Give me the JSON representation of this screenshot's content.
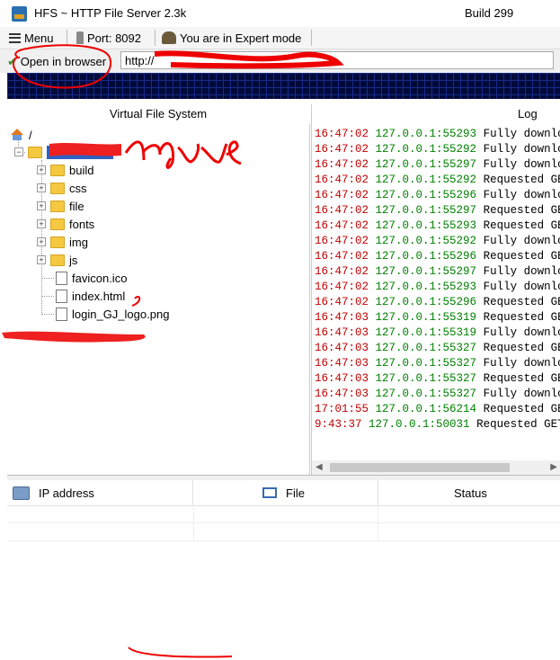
{
  "window": {
    "title": "HFS ~ HTTP File Server 2.3k",
    "build": "Build 299"
  },
  "toolbar": {
    "menu_label": "Menu",
    "port_label": "Port: 8092",
    "mode_label": "You are in Expert mode"
  },
  "urlbar": {
    "open_label": "Open in browser",
    "url_value": "http://"
  },
  "vfs": {
    "header": "Virtual File System",
    "root_label": "/",
    "items": [
      {
        "label": "build",
        "type": "folder"
      },
      {
        "label": "css",
        "type": "folder"
      },
      {
        "label": "file",
        "type": "folder"
      },
      {
        "label": "fonts",
        "type": "folder"
      },
      {
        "label": "img",
        "type": "folder"
      },
      {
        "label": "js",
        "type": "folder"
      },
      {
        "label": "favicon.ico",
        "type": "file"
      },
      {
        "label": "index.html",
        "type": "file"
      },
      {
        "label": "login_GJ_logo.png",
        "type": "file"
      }
    ]
  },
  "log": {
    "header": "Log",
    "lines": [
      {
        "time": "16:47:02",
        "ip": "127.0.0.1:55293",
        "msg": "Fully download"
      },
      {
        "time": "16:47:02",
        "ip": "127.0.0.1:55292",
        "msg": "Fully download"
      },
      {
        "time": "16:47:02",
        "ip": "127.0.0.1:55297",
        "msg": "Fully download"
      },
      {
        "time": "16:47:02",
        "ip": "127.0.0.1:55292",
        "msg": "Requested GET"
      },
      {
        "time": "16:47:02",
        "ip": "127.0.0.1:55296",
        "msg": "Fully download"
      },
      {
        "time": "16:47:02",
        "ip": "127.0.0.1:55297",
        "msg": "Requested GET"
      },
      {
        "time": "16:47:02",
        "ip": "127.0.0.1:55293",
        "msg": "Requested GET"
      },
      {
        "time": "16:47:02",
        "ip": "127.0.0.1:55292",
        "msg": "Fully download"
      },
      {
        "time": "16:47:02",
        "ip": "127.0.0.1:55296",
        "msg": "Requested GET"
      },
      {
        "time": "16:47:02",
        "ip": "127.0.0.1:55297",
        "msg": "Fully download"
      },
      {
        "time": "16:47:02",
        "ip": "127.0.0.1:55293",
        "msg": "Fully download"
      },
      {
        "time": "16:47:02",
        "ip": "127.0.0.1:55296",
        "msg": "Requested GET"
      },
      {
        "time": "16:47:03",
        "ip": "127.0.0.1:55319",
        "msg": "Requested GET"
      },
      {
        "time": "16:47:03",
        "ip": "127.0.0.1:55319",
        "msg": "Fully download"
      },
      {
        "time": "16:47:03",
        "ip": "127.0.0.1:55327",
        "msg": "Requested GET"
      },
      {
        "time": "16:47:03",
        "ip": "127.0.0.1:55327",
        "msg": "Fully download"
      },
      {
        "time": "16:47:03",
        "ip": "127.0.0.1:55327",
        "msg": "Requested GET"
      },
      {
        "time": "16:47:03",
        "ip": "127.0.0.1:55327",
        "msg": "Fully download"
      },
      {
        "time": "17:01:55",
        "ip": "127.0.0.1:56214",
        "msg": "Requested GET"
      },
      {
        "time": "9:43:37",
        "ip": "127.0.0.1:50031",
        "msg": "Requested GET /"
      }
    ]
  },
  "connections": {
    "col_ip": "IP address",
    "col_file": "File",
    "col_status": "Status"
  },
  "colors": {
    "log_time": "#c00000",
    "log_ip": "#008000",
    "scribble": "#ee0000"
  }
}
